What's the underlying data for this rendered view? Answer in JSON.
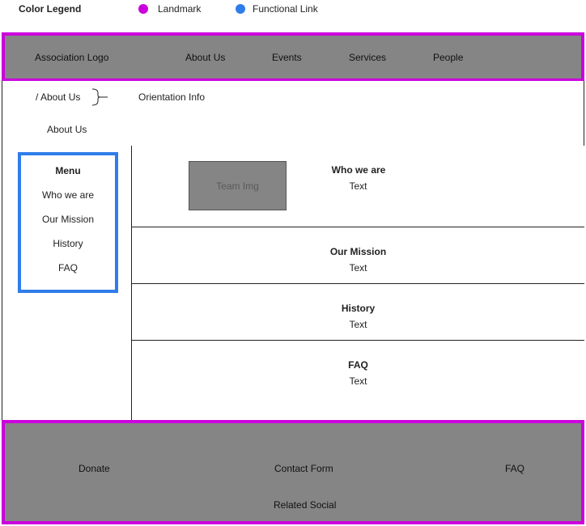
{
  "legend": {
    "title": "Color Legend",
    "items": [
      {
        "label": "Landmark",
        "color": "#cc00dd"
      },
      {
        "label": "Functional Link",
        "color": "#2f7de9"
      }
    ]
  },
  "header": {
    "logo": "Association Logo",
    "nav": [
      "About Us",
      "Events",
      "Services",
      "People"
    ]
  },
  "breadcrumb": {
    "path": "/ About Us",
    "note": "Orientation Info"
  },
  "page_title": "About Us",
  "sidebar": {
    "heading": "Menu",
    "items": [
      "Who we are",
      "Our Mission",
      "History",
      "FAQ"
    ]
  },
  "sections": [
    {
      "title": "Who we are",
      "text": "Text",
      "image_label": "Team Img"
    },
    {
      "title": "Our Mission",
      "text": "Text"
    },
    {
      "title": "History",
      "text": "Text"
    },
    {
      "title": "FAQ",
      "text": "Text"
    }
  ],
  "footer": {
    "links": [
      "Donate",
      "Contact Form",
      "FAQ"
    ],
    "social": "Related Social"
  }
}
